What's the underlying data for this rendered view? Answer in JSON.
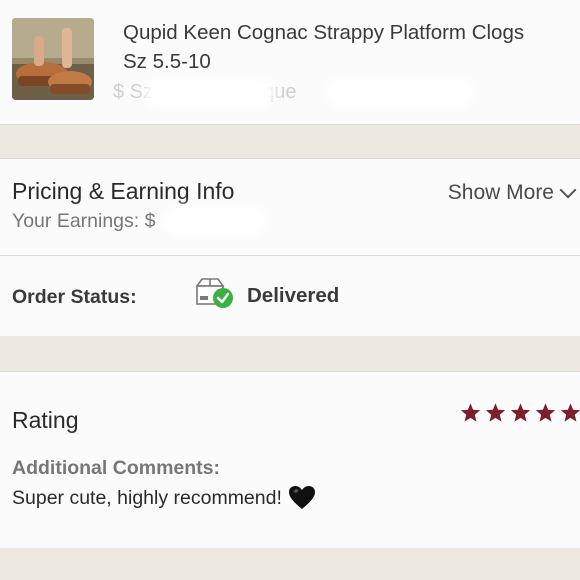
{
  "product": {
    "title_line1": "Qupid Keen Cognac Strappy Platform Clogs",
    "title_line2": "Sz 5.5-10",
    "thumbnail_icon": "sandal-photo",
    "price_line": "$         Sz  Qupid      Boutique"
  },
  "pricing": {
    "title": "Pricing & Earning Info",
    "show_more": "Show More",
    "earnings_label": "Your Earnings: $"
  },
  "order_status": {
    "label": "Order Status:",
    "value": "Delivered",
    "icon": "box-check-icon",
    "check_color": "#3cb043"
  },
  "rating": {
    "title": "Rating",
    "stars": 5,
    "max_stars": 5,
    "star_color": "#7a1f2b",
    "comments_label": "Additional Comments:",
    "comment": "Super cute, highly recommend!",
    "comment_emoji": "black-heart-icon"
  }
}
